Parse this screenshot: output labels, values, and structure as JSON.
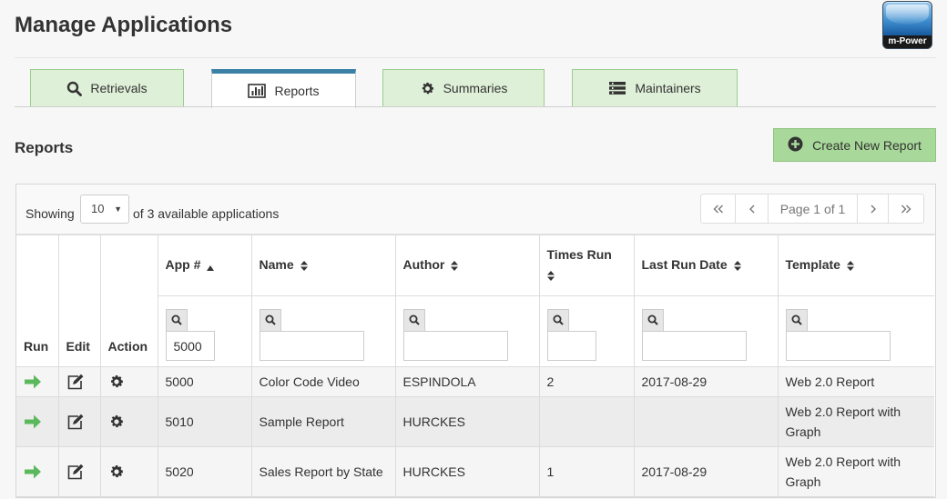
{
  "page": {
    "title": "Manage Applications"
  },
  "logo": {
    "label": "m-Power"
  },
  "tabs": [
    {
      "label": "Retrievals",
      "icon": "search-icon"
    },
    {
      "label": "Reports",
      "icon": "bar-chart-icon",
      "active": true
    },
    {
      "label": "Summaries",
      "icon": "gear-icon"
    },
    {
      "label": "Maintainers",
      "icon": "list-icon"
    }
  ],
  "section": {
    "title": "Reports",
    "create_label": "Create New Report"
  },
  "listing": {
    "showing_label": "Showing",
    "page_size": "10",
    "available_text": "of 3 available applications",
    "page_label": "Page 1 of 1"
  },
  "table": {
    "columns": {
      "run": "Run",
      "edit": "Edit",
      "action": "Action",
      "app": "App #",
      "name": "Name",
      "author": "Author",
      "times_run": "Times Run",
      "last_run": "Last Run Date",
      "template": "Template"
    },
    "filters": {
      "app": "5000",
      "name": "",
      "author": "",
      "times_run": "",
      "last_run": "",
      "template": ""
    },
    "rows": [
      {
        "app": "5000",
        "name": "Color Code Video",
        "author": "ESPINDOLA",
        "times_run": "2",
        "last_run": "2017-08-29",
        "template": "Web 2.0 Report"
      },
      {
        "app": "5010",
        "name": "Sample Report",
        "author": "HURCKES",
        "times_run": "",
        "last_run": "",
        "template": "Web 2.0 Report with Graph"
      },
      {
        "app": "5020",
        "name": "Sales Report by State",
        "author": "HURCKES",
        "times_run": "1",
        "last_run": "2017-08-29",
        "template": "Web 2.0 Report with Graph"
      }
    ]
  },
  "colors": {
    "tab_green": "#dff0d8",
    "active_tab_border": "#3b80a6",
    "button_green": "#a8d99a",
    "run_arrow": "#5cb85c"
  }
}
